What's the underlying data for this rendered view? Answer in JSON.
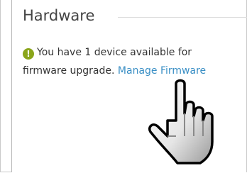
{
  "section": {
    "title": "Hardware"
  },
  "notice": {
    "icon": "exclamation-icon",
    "icon_glyph": "!",
    "icon_color": "#8aa51a",
    "text_line1": "You have 1 device available for",
    "text_line2": "firmware upgrade.",
    "link_label": "Manage Firmware",
    "link_color": "#3a8fc5"
  },
  "pointer": {
    "icon": "hand-pointer-icon"
  }
}
